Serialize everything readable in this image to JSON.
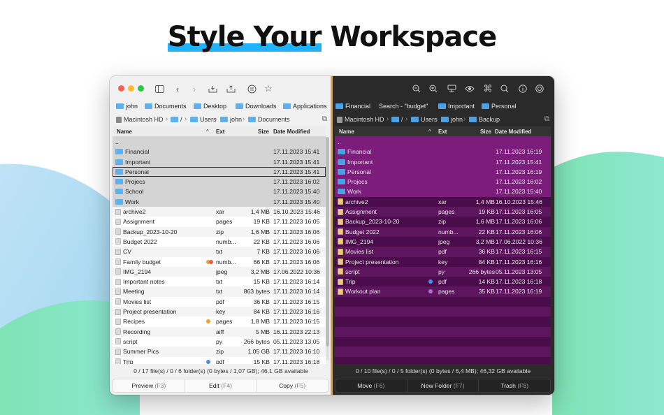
{
  "headline": {
    "part1": "Style Your",
    "part2": "Workspace"
  },
  "colors": {
    "accent_underline": "#1fb3ff",
    "divider": "#f19b2c",
    "dark_list_bg": "#4b0c4b",
    "traffic_red": "#fe5f57",
    "traffic_yellow": "#febc2e",
    "traffic_green": "#28c840"
  },
  "left": {
    "toolbar_icons": [
      "sidebar-icon",
      "back-icon",
      "forward-icon",
      "inbox-in-icon",
      "inbox-out-icon",
      "list-icon",
      "star-icon"
    ],
    "favorites": [
      "john",
      "Documents",
      "Desktop",
      "Downloads",
      "Applications"
    ],
    "path": [
      "Macintosh HD",
      "/",
      "Users",
      "john",
      "Documents"
    ],
    "columns": {
      "name": "Name",
      "ext": "Ext",
      "size": "Size",
      "date": "Date Modified"
    },
    "rows": [
      {
        "name": "..",
        "ext": "",
        "size": "",
        "date": "",
        "type": "up"
      },
      {
        "name": "Financial",
        "ext": "",
        "size": "",
        "date": "17.11.2023 15:41",
        "type": "folder"
      },
      {
        "name": "Important",
        "ext": "",
        "size": "",
        "date": "17.11.2023 15:41",
        "type": "folder"
      },
      {
        "name": "Personal",
        "ext": "",
        "size": "",
        "date": "17.11.2023 15:41",
        "type": "folder"
      },
      {
        "name": "Projecs",
        "ext": "",
        "size": "",
        "date": "17.11.2023 16:02",
        "type": "folder"
      },
      {
        "name": "School",
        "ext": "",
        "size": "",
        "date": "17.11.2023 15:40",
        "type": "folder"
      },
      {
        "name": "Work",
        "ext": "",
        "size": "",
        "date": "17.11.2023 15:40",
        "type": "folder"
      },
      {
        "name": "archive2",
        "ext": "xar",
        "size": "1,4 MB",
        "date": "16.10.2023 15:46",
        "type": "file"
      },
      {
        "name": "Assignment",
        "ext": "pages",
        "size": "19 KB",
        "date": "17.11.2023 16:05",
        "type": "file"
      },
      {
        "name": "Backup_2023-10-20",
        "ext": "zip",
        "size": "1,6 MB",
        "date": "17.11.2023 16:06",
        "type": "file"
      },
      {
        "name": "Budget 2022",
        "ext": "numb...",
        "size": "22 KB",
        "date": "17.11.2023 16:06",
        "type": "file"
      },
      {
        "name": "CV",
        "ext": "txt",
        "size": "7 KB",
        "date": "17.11.2023 16:06",
        "type": "file"
      },
      {
        "name": "Family budget",
        "ext": "numb...",
        "size": "66 KB",
        "date": "17.11.2023 16:06",
        "type": "file",
        "tags": [
          "#f0a030",
          "#e06050"
        ]
      },
      {
        "name": "IMG_2194",
        "ext": "jpeg",
        "size": "3,2 MB",
        "date": "17.06.2022 10:36",
        "type": "file"
      },
      {
        "name": "Important notes",
        "ext": "txt",
        "size": "15 KB",
        "date": "17.11.2023 16:14",
        "type": "file"
      },
      {
        "name": "Meeting",
        "ext": "txt",
        "size": "863 bytes",
        "date": "17.11.2023 16:14",
        "type": "file"
      },
      {
        "name": "Movies list",
        "ext": "pdf",
        "size": "36 KB",
        "date": "17.11.2023 16:15",
        "type": "file"
      },
      {
        "name": "Project presentation",
        "ext": "key",
        "size": "84 KB",
        "date": "17.11.2023 16:16",
        "type": "file"
      },
      {
        "name": "Recipes",
        "ext": "pages",
        "size": "1,8 MB",
        "date": "17.11.2023 16:15",
        "type": "file",
        "tags": [
          "#f0a030"
        ]
      },
      {
        "name": "Recording",
        "ext": "aiff",
        "size": "5 MB",
        "date": "16.11.2023 22:13",
        "type": "file"
      },
      {
        "name": "script",
        "ext": "py",
        "size": "266 bytes",
        "date": "05.11.2023 13:05",
        "type": "file"
      },
      {
        "name": "Summer Pics",
        "ext": "zip",
        "size": "1,05 GB",
        "date": "17.11.2023 16:10",
        "type": "file"
      },
      {
        "name": "Trip",
        "ext": "pdf",
        "size": "15 KB",
        "date": "17.11.2023 16:18",
        "type": "file",
        "tags": [
          "#4a90e2"
        ]
      }
    ],
    "status": "0 / 17 file(s) / 0 / 6 folder(s) (0 bytes / 1,07 GB); 46,1 GB available",
    "buttons": [
      {
        "label": "Preview",
        "key": "(F3)"
      },
      {
        "label": "Edit",
        "key": "(F4)"
      },
      {
        "label": "Copy",
        "key": "(F5)"
      }
    ]
  },
  "right": {
    "toolbar_icons": [
      "zoom-out-icon",
      "zoom-in-icon",
      "drive-icon",
      "eye-icon",
      "command-icon",
      "search-icon",
      "info-icon",
      "sync-icon"
    ],
    "favorites": [
      "Financial",
      "Search - \"budget\"",
      "Important",
      "Personal"
    ],
    "path": [
      "Macintosh HD",
      "/",
      "Users",
      "john",
      "Backup"
    ],
    "columns": {
      "name": "Name",
      "ext": "Ext",
      "size": "Size",
      "date": "Date Modified"
    },
    "rows": [
      {
        "name": "..",
        "ext": "",
        "size": "",
        "date": "",
        "type": "up"
      },
      {
        "name": "Financial",
        "ext": "",
        "size": "",
        "date": "17.11.2023 16:19",
        "type": "folder"
      },
      {
        "name": "Important",
        "ext": "",
        "size": "",
        "date": "17.11.2023 15:41",
        "type": "folder"
      },
      {
        "name": "Personal",
        "ext": "",
        "size": "",
        "date": "17.11.2023 16:19",
        "type": "folder"
      },
      {
        "name": "Projecs",
        "ext": "",
        "size": "",
        "date": "17.11.2023 16:02",
        "type": "folder"
      },
      {
        "name": "Work",
        "ext": "",
        "size": "",
        "date": "17.11.2023 15:40",
        "type": "folder"
      },
      {
        "name": "archive2",
        "ext": "xar",
        "size": "1,4 MB",
        "date": "16.10.2023 15:46",
        "type": "file"
      },
      {
        "name": "Assignment",
        "ext": "pages",
        "size": "19 KB",
        "date": "17.11.2023 16:05",
        "type": "file"
      },
      {
        "name": "Backup_2023-10-20",
        "ext": "zip",
        "size": "1,6 MB",
        "date": "17.11.2023 16:06",
        "type": "file"
      },
      {
        "name": "Budget 2022",
        "ext": "numb...",
        "size": "22 KB",
        "date": "17.11.2023 16:06",
        "type": "file"
      },
      {
        "name": "IMG_2194",
        "ext": "jpeg",
        "size": "3,2 MB",
        "date": "17.06.2022 10:36",
        "type": "file"
      },
      {
        "name": "Movies list",
        "ext": "pdf",
        "size": "36 KB",
        "date": "17.11.2023 16:15",
        "type": "file"
      },
      {
        "name": "Project presentation",
        "ext": "key",
        "size": "84 KB",
        "date": "17.11.2023 16:16",
        "type": "file"
      },
      {
        "name": "script",
        "ext": "py",
        "size": "266 bytes",
        "date": "05.11.2023 13:05",
        "type": "file"
      },
      {
        "name": "Trip",
        "ext": "pdf",
        "size": "14 KB",
        "date": "17.11.2023 16:18",
        "type": "file",
        "tags": [
          "#4a90e2"
        ]
      },
      {
        "name": "Workout plan",
        "ext": "pages",
        "size": "35 KB",
        "date": "17.11.2023 16:19",
        "type": "file",
        "tags": [
          "#b070d0"
        ]
      }
    ],
    "status": "0 / 10 file(s) / 0 / 5 folder(s) (0 bytes / 6,4 MB); 46,32 GB available",
    "buttons": [
      {
        "label": "Move",
        "key": "(F6)"
      },
      {
        "label": "New Folder",
        "key": "(F7)"
      },
      {
        "label": "Trash",
        "key": "(F8)"
      }
    ]
  }
}
